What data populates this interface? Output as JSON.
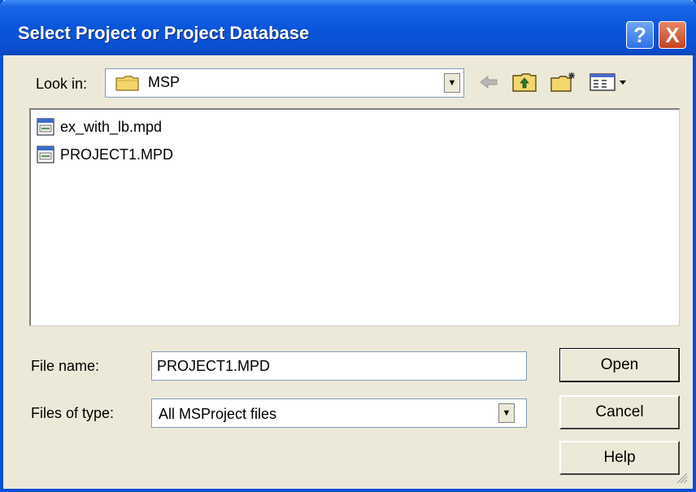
{
  "window": {
    "title": "Select Project or Project Database",
    "help_button": "?",
    "close_button": "X"
  },
  "lookin": {
    "label": "Look in:",
    "value": "MSP"
  },
  "toolbar": {
    "icons": [
      "back-arrow-icon",
      "up-folder-icon",
      "new-folder-icon",
      "view-menu-icon"
    ]
  },
  "files": [
    {
      "name": "ex_with_lb.mpd",
      "icon": "mpd-file-icon"
    },
    {
      "name": "PROJECT1.MPD",
      "icon": "mpd-file-icon"
    }
  ],
  "filename": {
    "label": "File name:",
    "value": "PROJECT1.MPD"
  },
  "filetype": {
    "label": "Files of type:",
    "value": "All MSProject files"
  },
  "buttons": {
    "open": "Open",
    "cancel": "Cancel",
    "help": "Help"
  },
  "colors": {
    "title_bar": "#0a56dc",
    "dialog_bg": "#ece9d8",
    "close_red": "#c5431e"
  }
}
